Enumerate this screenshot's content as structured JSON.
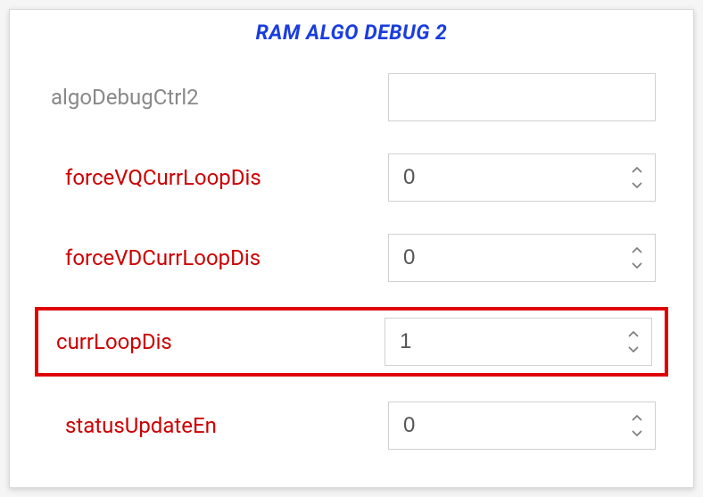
{
  "panel": {
    "title": "RAM ALGO DEBUG 2"
  },
  "fields": {
    "algoDebugCtrl2": {
      "label": "algoDebugCtrl2",
      "value": ""
    },
    "forceVQCurrLoopDis": {
      "label": "forceVQCurrLoopDis",
      "value": "0"
    },
    "forceVDCurrLoopDis": {
      "label": "forceVDCurrLoopDis",
      "value": "0"
    },
    "currLoopDis": {
      "label": "currLoopDis",
      "value": "1",
      "highlighted": true
    },
    "statusUpdateEn": {
      "label": "statusUpdateEn",
      "value": "0"
    }
  }
}
